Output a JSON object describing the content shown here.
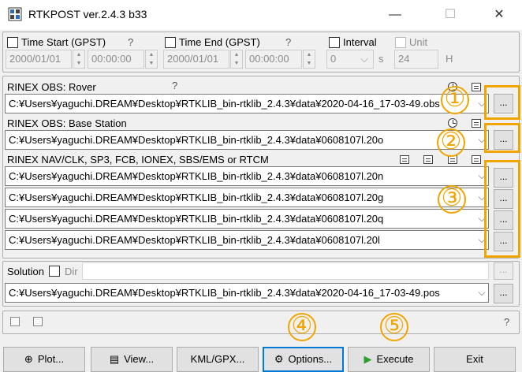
{
  "window": {
    "title": "RTKPOST ver.2.4.3 b33",
    "minimize": "—",
    "maximize": "☐",
    "close": "✕"
  },
  "time": {
    "start_label": "Time Start (GPST)",
    "start_help": "?",
    "start_date": "2000/01/01",
    "start_time": "00:00:00",
    "end_label": "Time End (GPST)",
    "end_help": "?",
    "end_date": "2000/01/01",
    "end_time": "00:00:00",
    "interval_label": "Interval",
    "interval_value": "0",
    "interval_unit": "s",
    "unit_label": "Unit",
    "unit_value": "24",
    "unit_unit": "H"
  },
  "inputs": {
    "rover_label": "RINEX OBS: Rover",
    "rover_help": "?",
    "rover_path": "C:¥Users¥yaguchi.DREAM¥Desktop¥RTKLIB_bin-rtklib_2.4.3¥data¥2020-04-16_17-03-49.obs",
    "base_label": "RINEX OBS: Base Station",
    "base_path": "C:¥Users¥yaguchi.DREAM¥Desktop¥RTKLIB_bin-rtklib_2.4.3¥data¥0608107l.20o",
    "nav_label": "RINEX NAV/CLK, SP3, FCB, IONEX, SBS/EMS  or RTCM",
    "nav_paths": [
      "C:¥Users¥yaguchi.DREAM¥Desktop¥RTKLIB_bin-rtklib_2.4.3¥data¥0608107l.20n",
      "C:¥Users¥yaguchi.DREAM¥Desktop¥RTKLIB_bin-rtklib_2.4.3¥data¥0608107l.20g",
      "C:¥Users¥yaguchi.DREAM¥Desktop¥RTKLIB_bin-rtklib_2.4.3¥data¥0608107l.20q",
      "C:¥Users¥yaguchi.DREAM¥Desktop¥RTKLIB_bin-rtklib_2.4.3¥data¥0608107l.20l"
    ],
    "browse_label": "..."
  },
  "solution": {
    "label": "Solution",
    "dir_label": "Dir",
    "path": "C:¥Users¥yaguchi.DREAM¥Desktop¥RTKLIB_bin-rtklib_2.4.3¥data¥2020-04-16_17-03-49.pos",
    "browse_label": "..."
  },
  "status": {
    "help": "?"
  },
  "buttons": {
    "plot": "Plot...",
    "view": "View...",
    "kml": "KML/GPX...",
    "options": "Options...",
    "execute": "Execute",
    "exit": "Exit"
  },
  "callouts": [
    "①",
    "②",
    "③",
    "④",
    "⑤"
  ],
  "colors": {
    "highlight": "#f0a500",
    "focus": "#0078d7",
    "execute_icon": "#2e9e2e"
  }
}
